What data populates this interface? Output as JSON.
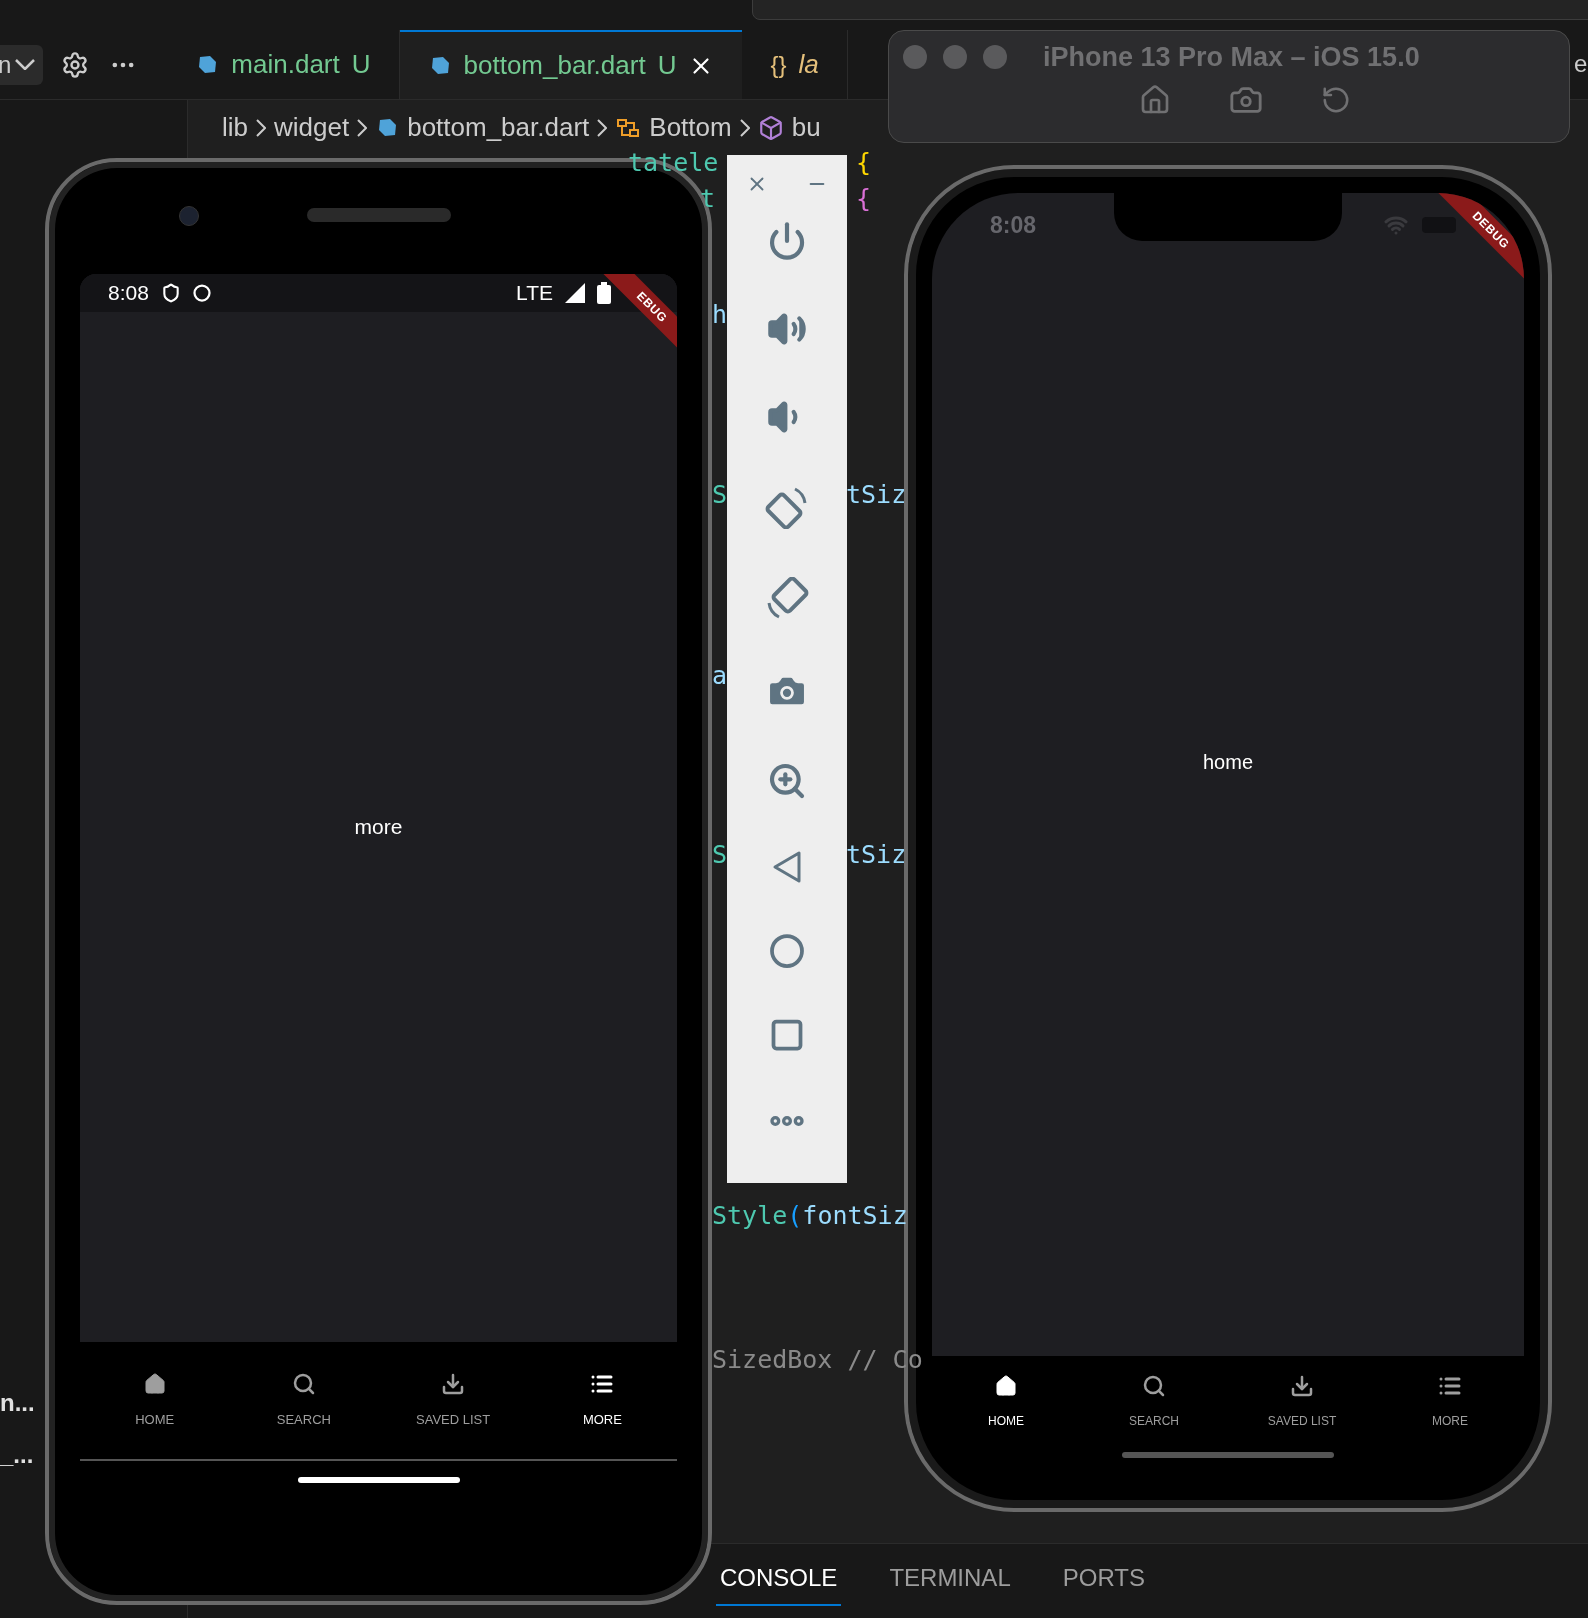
{
  "editor": {
    "dropdown": "n",
    "tabs": [
      {
        "kind": "dart",
        "label": "main.dart",
        "badge": "U",
        "selected": false
      },
      {
        "kind": "dart",
        "label": "bottom_bar.dart",
        "badge": "U",
        "selected": true
      },
      {
        "kind": "json",
        "glyph": "{}",
        "label": "la",
        "selected": false
      }
    ],
    "breadcrumb": [
      "lib",
      "widget",
      "bottom_bar.dart",
      "Bottom",
      "bu"
    ],
    "code_fragments": [
      [
        {
          "text": "tatele",
          "kind": "type"
        }
      ],
      [
        {
          "text": "t",
          "kind": "type"
        }
      ],
      [
        {
          "text": "{",
          "kind": "brace"
        }
      ],
      [
        {
          "text": "{",
          "kind": "brace2"
        }
      ],
      [
        {
          "text": "h",
          "kind": "property"
        }
      ],
      [
        {
          "text": "S",
          "kind": "type"
        }
      ],
      [
        {
          "text": "tSiz",
          "kind": "property"
        }
      ],
      [
        {
          "text": "a",
          "kind": "property"
        }
      ],
      [
        {
          "text": "S",
          "kind": "type"
        }
      ],
      [
        {
          "text": "tSiz",
          "kind": "property"
        }
      ],
      [
        {
          "text": "Style",
          "kind": "type"
        },
        {
          "text": "(",
          "kind": "paren"
        },
        {
          "text": "fontSiz",
          "kind": "property"
        }
      ],
      [
        {
          "text": "SizedBox // Co",
          "kind": "comment"
        }
      ]
    ]
  },
  "sidebar": {
    "items": [
      "n...",
      "_..."
    ]
  },
  "panel_tabs": [
    {
      "label": "CONSOLE",
      "selected": true
    },
    {
      "label": "TERMINAL",
      "selected": false
    },
    {
      "label": "PORTS",
      "selected": false
    }
  ],
  "android": {
    "time": "8:08",
    "network": "LTE",
    "debug": "EBUG",
    "body": "more",
    "nav": [
      {
        "kind": "home",
        "label": "HOME",
        "selected": false
      },
      {
        "kind": "search",
        "label": "SEARCH",
        "selected": false
      },
      {
        "kind": "saved",
        "label": "SAVED LIST",
        "selected": false
      },
      {
        "kind": "more",
        "label": "MORE",
        "selected": true
      }
    ]
  },
  "simulator": {
    "title": "iPhone 13 Pro Max – iOS 15.0",
    "right_edge": "e"
  },
  "iphone": {
    "time": "8:08",
    "debug": "DEBUG",
    "body": "home",
    "nav": [
      {
        "kind": "home",
        "label": "HOME",
        "selected": true
      },
      {
        "kind": "search",
        "label": "SEARCH",
        "selected": false
      },
      {
        "kind": "saved",
        "label": "SAVED LIST",
        "selected": false
      },
      {
        "kind": "more",
        "label": "MORE",
        "selected": false
      }
    ]
  }
}
